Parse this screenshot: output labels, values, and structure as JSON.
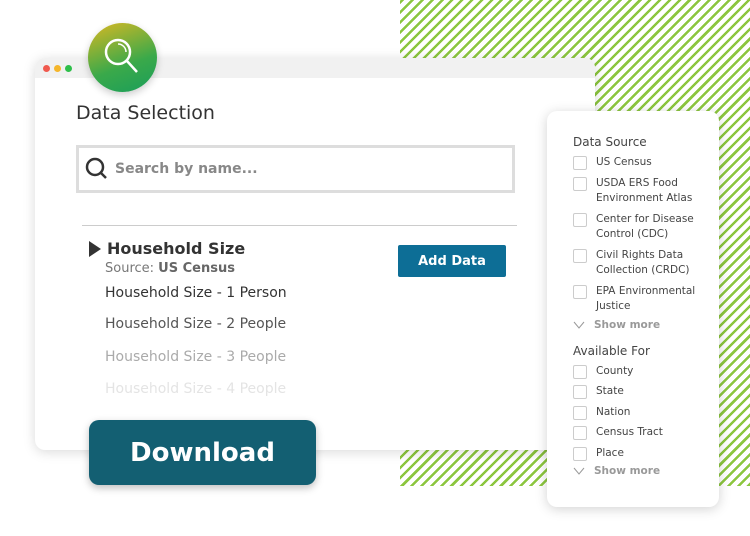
{
  "window": {
    "title": "Data Selection",
    "dots": [
      "#f05a4f",
      "#f5b62b",
      "#2ebf4a"
    ]
  },
  "search": {
    "placeholder": "Search by name..."
  },
  "results": {
    "group": "Household Size",
    "source_label": "Source:",
    "source": "US Census",
    "add_label": "Add Data",
    "items": [
      "Household Size - 1 Person",
      "Household Size - 2 People",
      "Household Size - 3 People",
      "Household Size - 4 People"
    ]
  },
  "download_label": "Download",
  "filters": {
    "data_source": {
      "title": "Data Source",
      "options": [
        "US Census",
        "USDA ERS Food Environment Atlas",
        "Center for Disease Control (CDC)",
        "Civil Rights Data Collection (CRDC)",
        "EPA Environmental Justice"
      ],
      "show_more": "Show more"
    },
    "available_for": {
      "title": "Available For",
      "options": [
        "County",
        "State",
        "Nation",
        "Census Tract",
        "Place"
      ],
      "show_more": "Show more"
    }
  }
}
